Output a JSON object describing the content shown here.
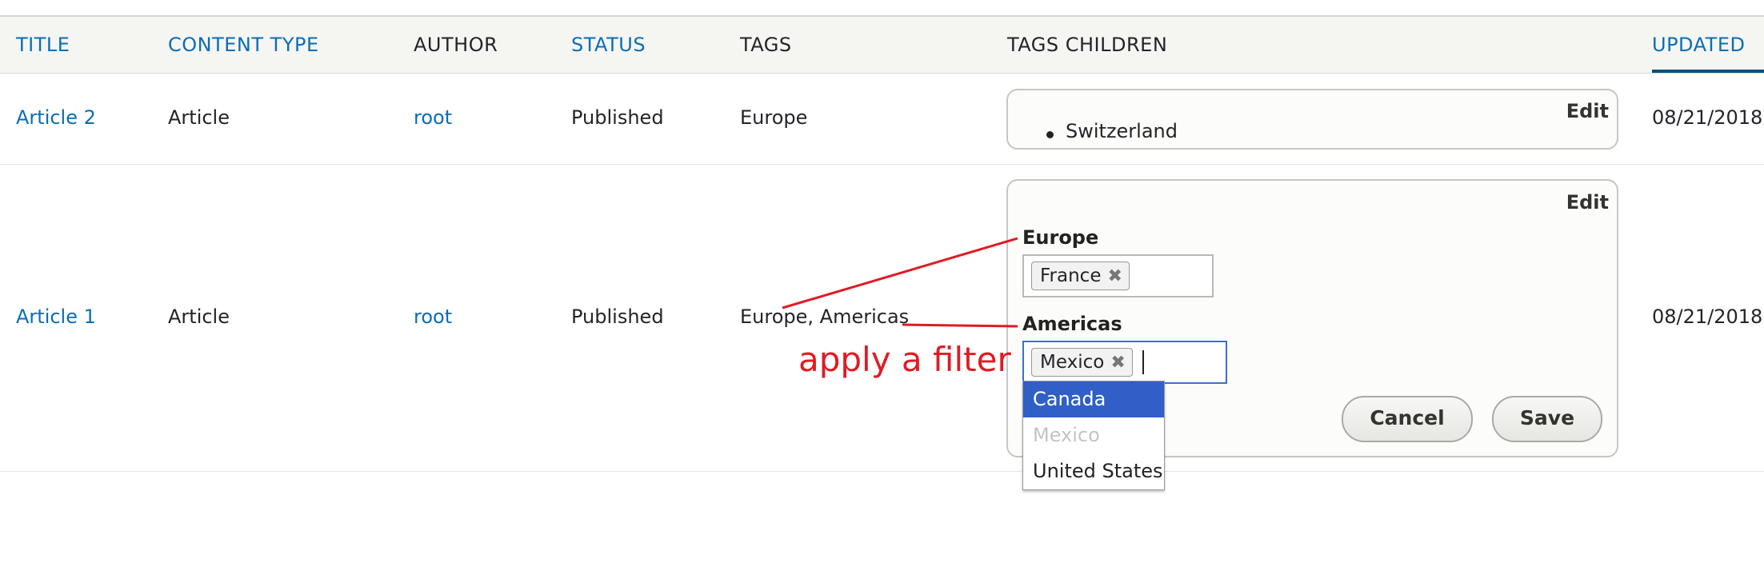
{
  "table": {
    "headers": {
      "title": "TITLE",
      "content_type": "CONTENT TYPE",
      "author": "AUTHOR",
      "status": "STATUS",
      "tags": "TAGS",
      "tags_children": "TAGS CHILDREN",
      "updated": "UPDATED"
    },
    "rows": [
      {
        "title": "Article 2",
        "content_type": "Article",
        "author": "root",
        "status": "Published",
        "tags": "Europe",
        "edit_label": "Edit",
        "children": [
          "Switzerland"
        ],
        "updated": "08/21/2018"
      },
      {
        "title": "Article 1",
        "content_type": "Article",
        "author": "root",
        "status": "Published",
        "tags": "Europe, Americas",
        "edit_label": "Edit",
        "fields": [
          {
            "label": "Europe",
            "chips": [
              "France"
            ]
          },
          {
            "label": "Americas",
            "chips": [
              "Mexico"
            ]
          }
        ],
        "dropdown": {
          "options": [
            "Canada",
            "Mexico",
            "United States"
          ],
          "highlighted": "Canada",
          "disabled": "Mexico"
        },
        "cancel_label": "Cancel",
        "save_label": "Save",
        "updated": "08/21/2018"
      }
    ]
  },
  "annotation": {
    "text": "apply a filter",
    "color": "#e01b24"
  },
  "colors": {
    "link": "#0a6eb4",
    "header_bg": "#f5f5f2",
    "highlight": "#2f5fc7"
  }
}
